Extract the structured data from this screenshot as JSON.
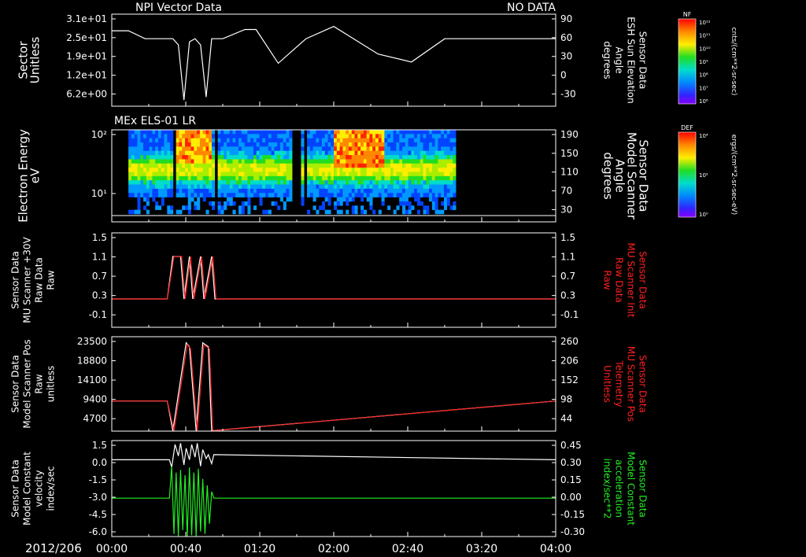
{
  "colors": {
    "background": "#000000",
    "foreground": "#ffffff",
    "red": "#ff2020",
    "green": "#22ee22"
  },
  "header": {
    "left_title": "NPI Vector Data",
    "right_title": "NO DATA"
  },
  "x_axis": {
    "date_label": "2012/206",
    "ticks": [
      "00:00",
      "00:40",
      "01:20",
      "02:00",
      "02:40",
      "03:20",
      "04:00"
    ],
    "range_hours": [
      0,
      4
    ]
  },
  "colorbars": [
    {
      "tag": "NF",
      "unit_label": "cnts/(cm**2-sr-sec)",
      "ticks": [
        "10¹²",
        "10¹¹",
        "10¹⁰",
        "10⁹",
        "10⁸",
        "10⁷",
        "10⁶"
      ]
    },
    {
      "tag": "DEF",
      "unit_label": "ergs/(cm**2-sr-sec-eV)",
      "ticks": [
        "10⁴",
        "10²",
        "10⁰"
      ]
    }
  ],
  "chart_data": [
    {
      "type": "line",
      "panel": "sector",
      "left_axis_label": [
        "Sector",
        "Unitless"
      ],
      "left_ticks": [
        "3.1e+01",
        "2.5e+01",
        "1.9e+01",
        "1.2e+01",
        "6.2e+00"
      ],
      "right_axis_label": [
        "Sensor Data",
        "ESH Sun Elevation",
        "Angle",
        "degrees"
      ],
      "right_ticks": [
        "90",
        "60",
        "30",
        "0",
        "-30"
      ],
      "ylim": [
        -60,
        90
      ],
      "series": [
        {
          "color": "white",
          "axis": "right",
          "x_hours": [
            0.0,
            0.15,
            0.3,
            0.55,
            0.6,
            0.65,
            0.7,
            0.75,
            0.8,
            0.85,
            0.9,
            1.0,
            1.2,
            1.3,
            1.5,
            1.75,
            2.0,
            2.4,
            2.7,
            3.0,
            3.1,
            3.2,
            4.0
          ],
          "y": [
            63,
            63,
            50,
            50,
            40,
            -50,
            45,
            50,
            40,
            -45,
            50,
            50,
            65,
            65,
            10,
            50,
            70,
            25,
            12,
            50,
            50,
            50,
            50
          ]
        }
      ]
    },
    {
      "type": "heatmap",
      "panel": "electron-spectrogram",
      "title": "MEx ELS-01 LR",
      "left_axis_label": [
        "Electron Energy",
        "eV"
      ],
      "left_ticks": [
        "10²",
        "10¹"
      ],
      "right_axis_label": [
        "Sensor Data",
        "Model Scanner",
        "Angle",
        "degrees"
      ],
      "right_ticks": [
        "190",
        "150",
        "110",
        "70",
        "30"
      ],
      "data_range_hours": [
        0.15,
        3.1
      ],
      "blank_after_hours": 3.1
    },
    {
      "type": "line",
      "panel": "mu-scanner-raw",
      "left_axis_label": [
        "Sensor Data",
        "MU Scanner +30V",
        "Raw Data",
        "Raw"
      ],
      "left_ticks": [
        "1.5",
        "1.1",
        "0.7",
        "0.3",
        "-0.1"
      ],
      "right_axis_label": [
        "Sensor Data",
        "MU Scanner Init",
        "Raw Data",
        "Raw"
      ],
      "right_ticks": [
        "1.5",
        "1.1",
        "0.7",
        "0.3",
        "-0.1"
      ],
      "ylim": [
        -0.5,
        1.5
      ],
      "series": [
        {
          "color": "white",
          "x_hours": [
            0.0,
            0.5,
            0.55,
            0.62,
            0.65,
            0.7,
            0.73,
            0.8,
            0.83,
            0.9,
            0.93,
            4.0
          ],
          "y": [
            0.1,
            0.1,
            1.0,
            1.0,
            0.1,
            1.0,
            0.1,
            1.0,
            0.1,
            1.0,
            0.1,
            0.1
          ]
        },
        {
          "color": "red",
          "x_hours": [
            0.0,
            0.5,
            0.56,
            0.63,
            0.66,
            0.71,
            0.74,
            0.81,
            0.84,
            0.91,
            0.94,
            4.0
          ],
          "y": [
            0.1,
            0.1,
            1.0,
            1.0,
            0.1,
            1.0,
            0.1,
            1.0,
            0.1,
            1.0,
            0.1,
            0.1
          ]
        }
      ]
    },
    {
      "type": "line",
      "panel": "scanner-position",
      "left_axis_label": [
        "Sensor Data",
        "Model Scanner Pos",
        "Raw",
        "unitless"
      ],
      "left_ticks": [
        "23500",
        "18800",
        "14100",
        "9400",
        "4700"
      ],
      "right_axis_label": [
        "Sensor Data",
        "MU Scanner Pos",
        "Telemetry",
        "Unitless"
      ],
      "right_ticks": [
        "260",
        "206",
        "152",
        "98",
        "44"
      ],
      "ylim": [
        0,
        23500
      ],
      "series": [
        {
          "color": "white",
          "x_hours": [
            0.0,
            0.5,
            0.55,
            0.67,
            0.7,
            0.76,
            0.82,
            0.87,
            0.9,
            4.0
          ],
          "y": [
            7500,
            7500,
            100,
            22000,
            21000,
            100,
            22000,
            21000,
            100,
            7500
          ]
        },
        {
          "color": "red",
          "x_hours": [
            0.0,
            0.5,
            0.56,
            0.68,
            0.71,
            0.77,
            0.83,
            0.88,
            0.91,
            4.0
          ],
          "y": [
            7500,
            7500,
            100,
            21500,
            20500,
            100,
            21500,
            20500,
            100,
            7500
          ]
        }
      ]
    },
    {
      "type": "line",
      "panel": "model-constant",
      "left_axis_label": [
        "Sensor Data",
        "Model Constant",
        "velocity",
        "index/sec"
      ],
      "left_ticks": [
        "1.5",
        "0.0",
        "-1.5",
        "-3.0",
        "-4.5",
        "-6.0"
      ],
      "right_axis_label": [
        "Sensor Data",
        "Model Constant",
        "acceleration",
        "index/sec**2"
      ],
      "right_ticks": [
        "0.45",
        "0.30",
        "0.15",
        "0.00",
        "-0.15",
        "-0.30"
      ],
      "ylim": [
        -6.0,
        1.5
      ],
      "series": [
        {
          "color": "white",
          "x_hours": [
            0.0,
            0.52,
            0.54,
            0.57,
            0.6,
            0.62,
            0.65,
            0.67,
            0.7,
            0.72,
            0.75,
            0.77,
            0.8,
            0.82,
            0.85,
            0.87,
            0.9,
            0.92,
            4.0
          ],
          "y": [
            0.0,
            0.0,
            -0.6,
            1.2,
            0.3,
            1.3,
            -0.4,
            0.9,
            0.0,
            1.2,
            0.2,
            1.3,
            -0.5,
            0.8,
            0.1,
            0.4,
            -0.3,
            0.4,
            0.0
          ]
        },
        {
          "color": "green",
          "x_hours": [
            0.0,
            0.52,
            0.54,
            0.56,
            0.58,
            0.6,
            0.62,
            0.64,
            0.66,
            0.68,
            0.7,
            0.72,
            0.74,
            0.76,
            0.78,
            0.8,
            0.82,
            0.84,
            0.86,
            0.88,
            0.9,
            0.92,
            4.0
          ],
          "y": [
            -3.0,
            -3.0,
            -0.5,
            -5.8,
            -1.0,
            -6.0,
            -0.8,
            -5.5,
            -1.2,
            -6.0,
            -0.6,
            -5.9,
            -1.0,
            -6.0,
            -0.7,
            -5.6,
            -1.5,
            -5.8,
            -2.0,
            -5.0,
            -2.5,
            -3.0,
            -3.0
          ]
        }
      ]
    }
  ]
}
